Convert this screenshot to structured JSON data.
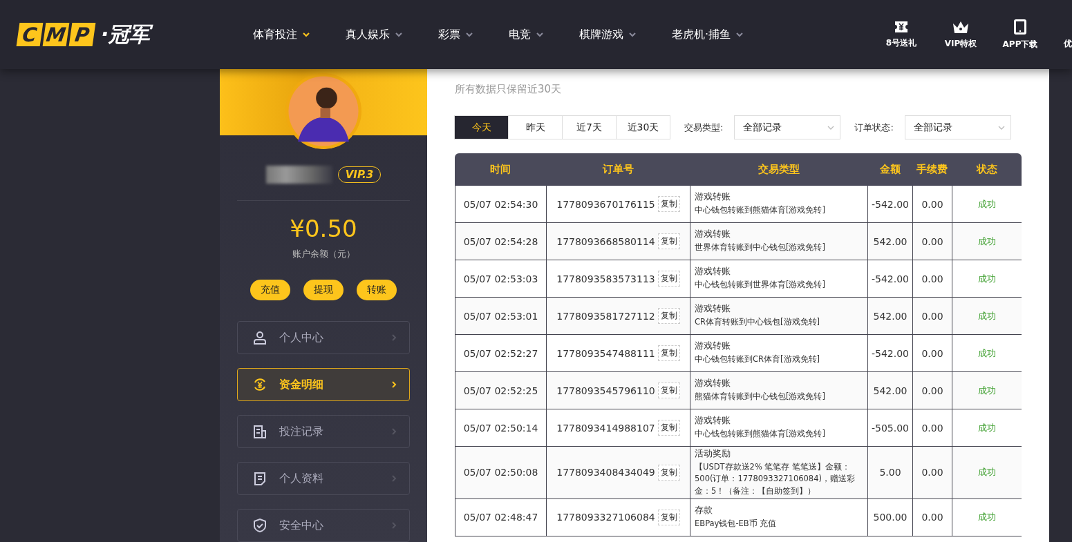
{
  "logo": {
    "letters": [
      "C",
      "M",
      "P"
    ],
    "name": "·冠军"
  },
  "nav": [
    {
      "label": "体育投注",
      "selected": true
    },
    {
      "label": "真人娱乐",
      "selected": false
    },
    {
      "label": "彩票",
      "selected": false
    },
    {
      "label": "电竞",
      "selected": false
    },
    {
      "label": "棋牌游戏",
      "selected": false
    },
    {
      "label": "老虎机·捕鱼",
      "selected": false
    }
  ],
  "header_links": [
    {
      "kind": "ticket",
      "label": "8号送礼"
    },
    {
      "kind": "crown",
      "label": "VIP特权"
    },
    {
      "kind": "tablet",
      "label": "APP下载"
    },
    {
      "kind": "cut",
      "label": "优"
    }
  ],
  "profile": {
    "vip": "VIP.3",
    "balance": "¥0.50",
    "balance_label": "账户余额（元）",
    "actions": [
      "充值",
      "提现",
      "转账"
    ]
  },
  "menu": [
    {
      "kind": "user",
      "label": "个人中心",
      "selected": false
    },
    {
      "kind": "money",
      "label": "资金明细",
      "selected": true
    },
    {
      "kind": "bets",
      "label": "投注记录",
      "selected": false
    },
    {
      "kind": "doc",
      "label": "个人资料",
      "selected": false
    },
    {
      "kind": "shield",
      "label": "安全中心",
      "selected": false
    }
  ],
  "subtitle": "所有数据只保留近30天",
  "ranges": [
    {
      "label": "今天",
      "selected": true
    },
    {
      "label": "昨天",
      "selected": false
    },
    {
      "label": "近7天",
      "selected": false
    },
    {
      "label": "近30天",
      "selected": false
    }
  ],
  "filters": [
    {
      "label": "交易类型:",
      "value": "全部记录"
    },
    {
      "label": "订单状态:",
      "value": "全部记录"
    }
  ],
  "table": {
    "columns": [
      "时间",
      "订单号",
      "交易类型",
      "金额",
      "手续费",
      "状态"
    ],
    "rows": [
      {
        "time": "05/07 02:54:30",
        "order": "1778093670176115",
        "copy": "复制",
        "type": "游戏转账",
        "detail": "中心钱包转账到熊猫体育[游戏免转]",
        "amount": "-542.00",
        "fee": "0.00",
        "status": "成功"
      },
      {
        "time": "05/07 02:54:28",
        "order": "1778093668580114",
        "copy": "复制",
        "type": "游戏转账",
        "detail": "世界体育转账到中心钱包[游戏免转]",
        "amount": "542.00",
        "fee": "0.00",
        "status": "成功"
      },
      {
        "time": "05/07 02:53:03",
        "order": "1778093583573113",
        "copy": "复制",
        "type": "游戏转账",
        "detail": "中心钱包转账到世界体育[游戏免转]",
        "amount": "-542.00",
        "fee": "0.00",
        "status": "成功"
      },
      {
        "time": "05/07 02:53:01",
        "order": "1778093581727112",
        "copy": "复制",
        "type": "游戏转账",
        "detail": "CR体育转账到中心钱包[游戏免转]",
        "amount": "542.00",
        "fee": "0.00",
        "status": "成功"
      },
      {
        "time": "05/07 02:52:27",
        "order": "1778093547488111",
        "copy": "复制",
        "type": "游戏转账",
        "detail": "中心钱包转账到CR体育[游戏免转]",
        "amount": "-542.00",
        "fee": "0.00",
        "status": "成功"
      },
      {
        "time": "05/07 02:52:25",
        "order": "1778093545796110",
        "copy": "复制",
        "type": "游戏转账",
        "detail": "熊猫体育转账到中心钱包[游戏免转]",
        "amount": "542.00",
        "fee": "0.00",
        "status": "成功"
      },
      {
        "time": "05/07 02:50:14",
        "order": "1778093414988107",
        "copy": "复制",
        "type": "游戏转账",
        "detail": "中心钱包转账到熊猫体育[游戏免转]",
        "amount": "-505.00",
        "fee": "0.00",
        "status": "成功"
      },
      {
        "time": "05/07 02:50:08",
        "order": "1778093408434049",
        "copy": "复制",
        "type": "活动奖励",
        "detail": "【USDT存款送2% 笔笔存 笔笔送】金额：500(订单：1778093327106084)，赠送彩金：5！（备注：【自助签到】）",
        "amount": "5.00",
        "fee": "0.00",
        "status": "成功"
      },
      {
        "time": "05/07 02:48:47",
        "order": "1778093327106084",
        "copy": "复制",
        "type": "存款",
        "detail": "EBPay钱包-EB币 充值",
        "amount": "500.00",
        "fee": "0.00",
        "status": "成功"
      }
    ]
  }
}
